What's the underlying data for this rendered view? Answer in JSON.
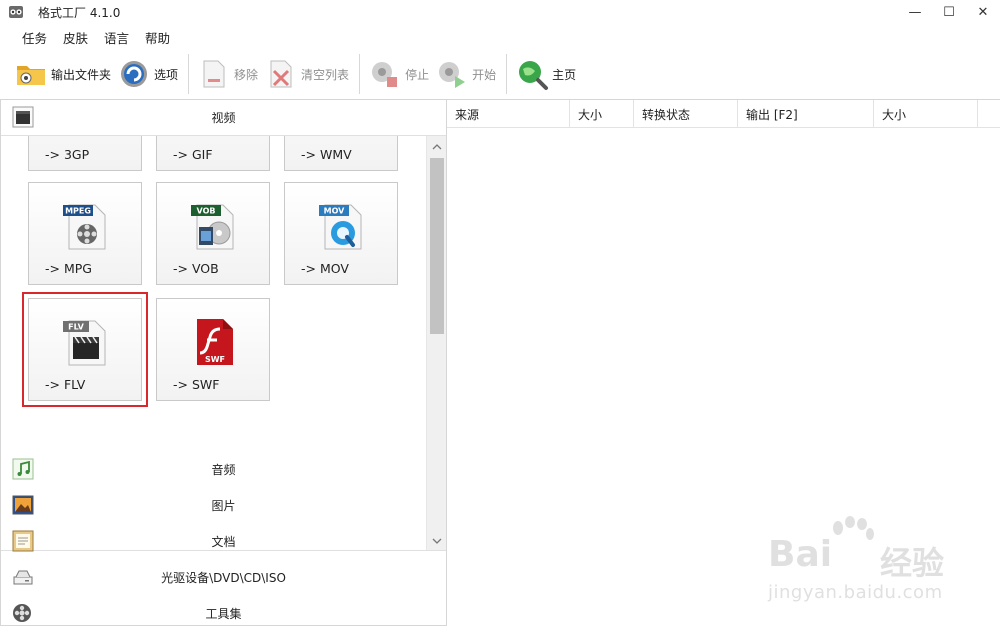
{
  "window": {
    "title": "格式工厂 4.1.0",
    "controls": [
      "—",
      "☐",
      "✕"
    ]
  },
  "menu": [
    "任务",
    "皮肤",
    "语言",
    "帮助"
  ],
  "toolbar": {
    "output_folder": "输出文件夹",
    "options": "选项",
    "remove": "移除",
    "clear_list": "清空列表",
    "stop": "停止",
    "start": "开始",
    "home": "主页"
  },
  "categories": {
    "video": "视频",
    "audio": "音频",
    "picture": "图片",
    "document": "文档",
    "rom": "光驱设备\\DVD\\CD\\ISO",
    "tools": "工具集"
  },
  "tiles": [
    {
      "label": "-> 3GP",
      "badge": ""
    },
    {
      "label": "-> GIF",
      "badge": ""
    },
    {
      "label": "-> WMV",
      "badge": ""
    },
    {
      "label": "-> MPG",
      "badge": "MPEG"
    },
    {
      "label": "-> VOB",
      "badge": "VOB"
    },
    {
      "label": "-> MOV",
      "badge": "MOV"
    },
    {
      "label": "-> FLV",
      "badge": "FLV"
    },
    {
      "label": "-> SWF",
      "badge": "SWF"
    }
  ],
  "task_list": {
    "columns": [
      "来源",
      "大小",
      "转换状态",
      "输出 [F2]",
      "大小"
    ]
  },
  "watermark": {
    "brand": "Bai",
    "cn": "经验",
    "url": "jingyan.baidu.com"
  },
  "colors": {
    "highlight": "#d9272e",
    "swf_red": "#c4161c",
    "mov_blue": "#2b7bbf"
  }
}
